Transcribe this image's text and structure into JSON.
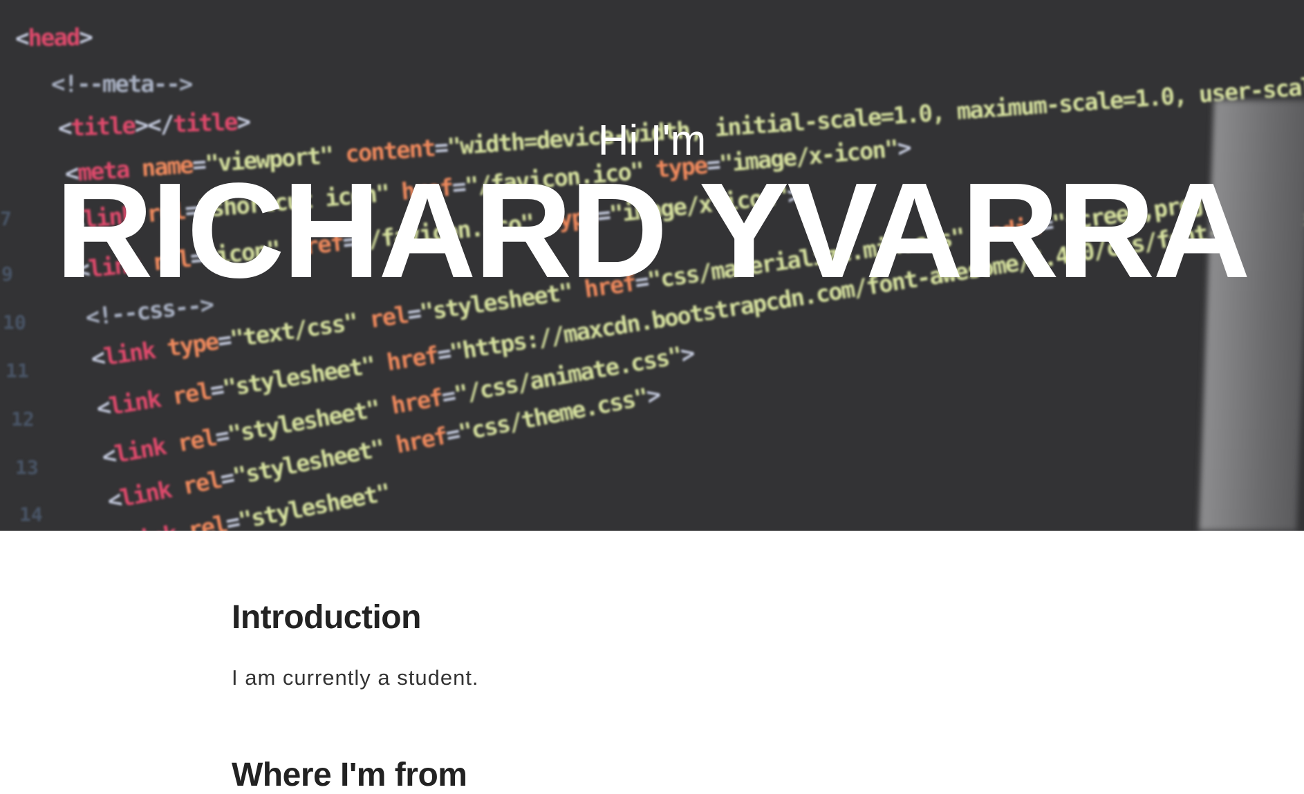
{
  "hero": {
    "greeting": "Hi I'm",
    "name": "RICHARD YVARRA"
  },
  "sections": [
    {
      "title": "Introduction",
      "text": "I am currently a student."
    },
    {
      "title": "Where I'm from"
    }
  ]
}
